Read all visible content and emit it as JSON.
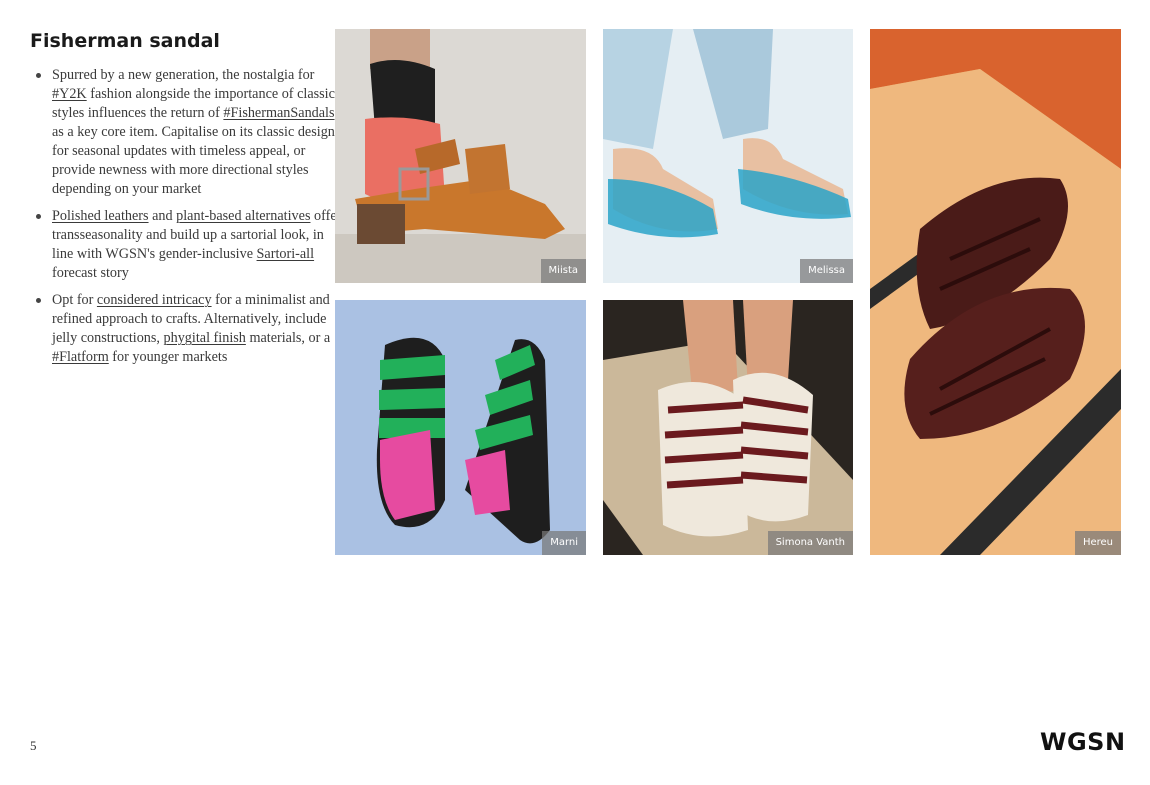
{
  "page": {
    "title": "Fisherman sandal",
    "page_number": "5",
    "logo": "WGSN"
  },
  "bullets": [
    {
      "parts": [
        {
          "text": "Spurred by a new generation, the nostalgia for "
        },
        {
          "text": "#Y2K",
          "link": true
        },
        {
          "text": " fashion alongside the importance of classic styles influences the return of "
        },
        {
          "text": "#FishermanSandals",
          "link": true
        },
        {
          "text": " as a key core item. Capitalise on its classic design for seasonal updates with timeless appeal, or provide newness with more directional styles depending on your market"
        }
      ]
    },
    {
      "parts": [
        {
          "text": "Polished leathers",
          "link": true
        },
        {
          "text": " and "
        },
        {
          "text": "plant-based alternatives",
          "link": true
        },
        {
          "text": " offer transseasonality and build up a sartorial look, in line with WGSN's gender-inclusive "
        },
        {
          "text": "Sartori-all",
          "link": true
        },
        {
          "text": " forecast story"
        }
      ]
    },
    {
      "parts": [
        {
          "text": "Opt for "
        },
        {
          "text": "considered intricacy",
          "link": true
        },
        {
          "text": " for a minimalist and refined approach to crafts. Alternatively, include jelly constructions, "
        },
        {
          "text": "phygital finish",
          "link": true
        },
        {
          "text": " materials, or a "
        },
        {
          "text": "#Flatform",
          "link": true
        },
        {
          "text": " for younger markets"
        }
      ]
    }
  ],
  "images": [
    {
      "credit": "Miista",
      "bg": "#d9d6d1",
      "accent": "#c9772c"
    },
    {
      "credit": "Melissa",
      "bg": "#e3edf3",
      "accent": "#2aa3c8"
    },
    {
      "credit": "Hereu",
      "bg": "#e6a25e",
      "accent": "#4a1b18"
    },
    {
      "credit": "Marni",
      "bg": "#a9bfe2",
      "accent": "#22b05a"
    },
    {
      "credit": "Simona Vanth",
      "bg": "#2a2520",
      "accent": "#6b1a1e"
    }
  ]
}
